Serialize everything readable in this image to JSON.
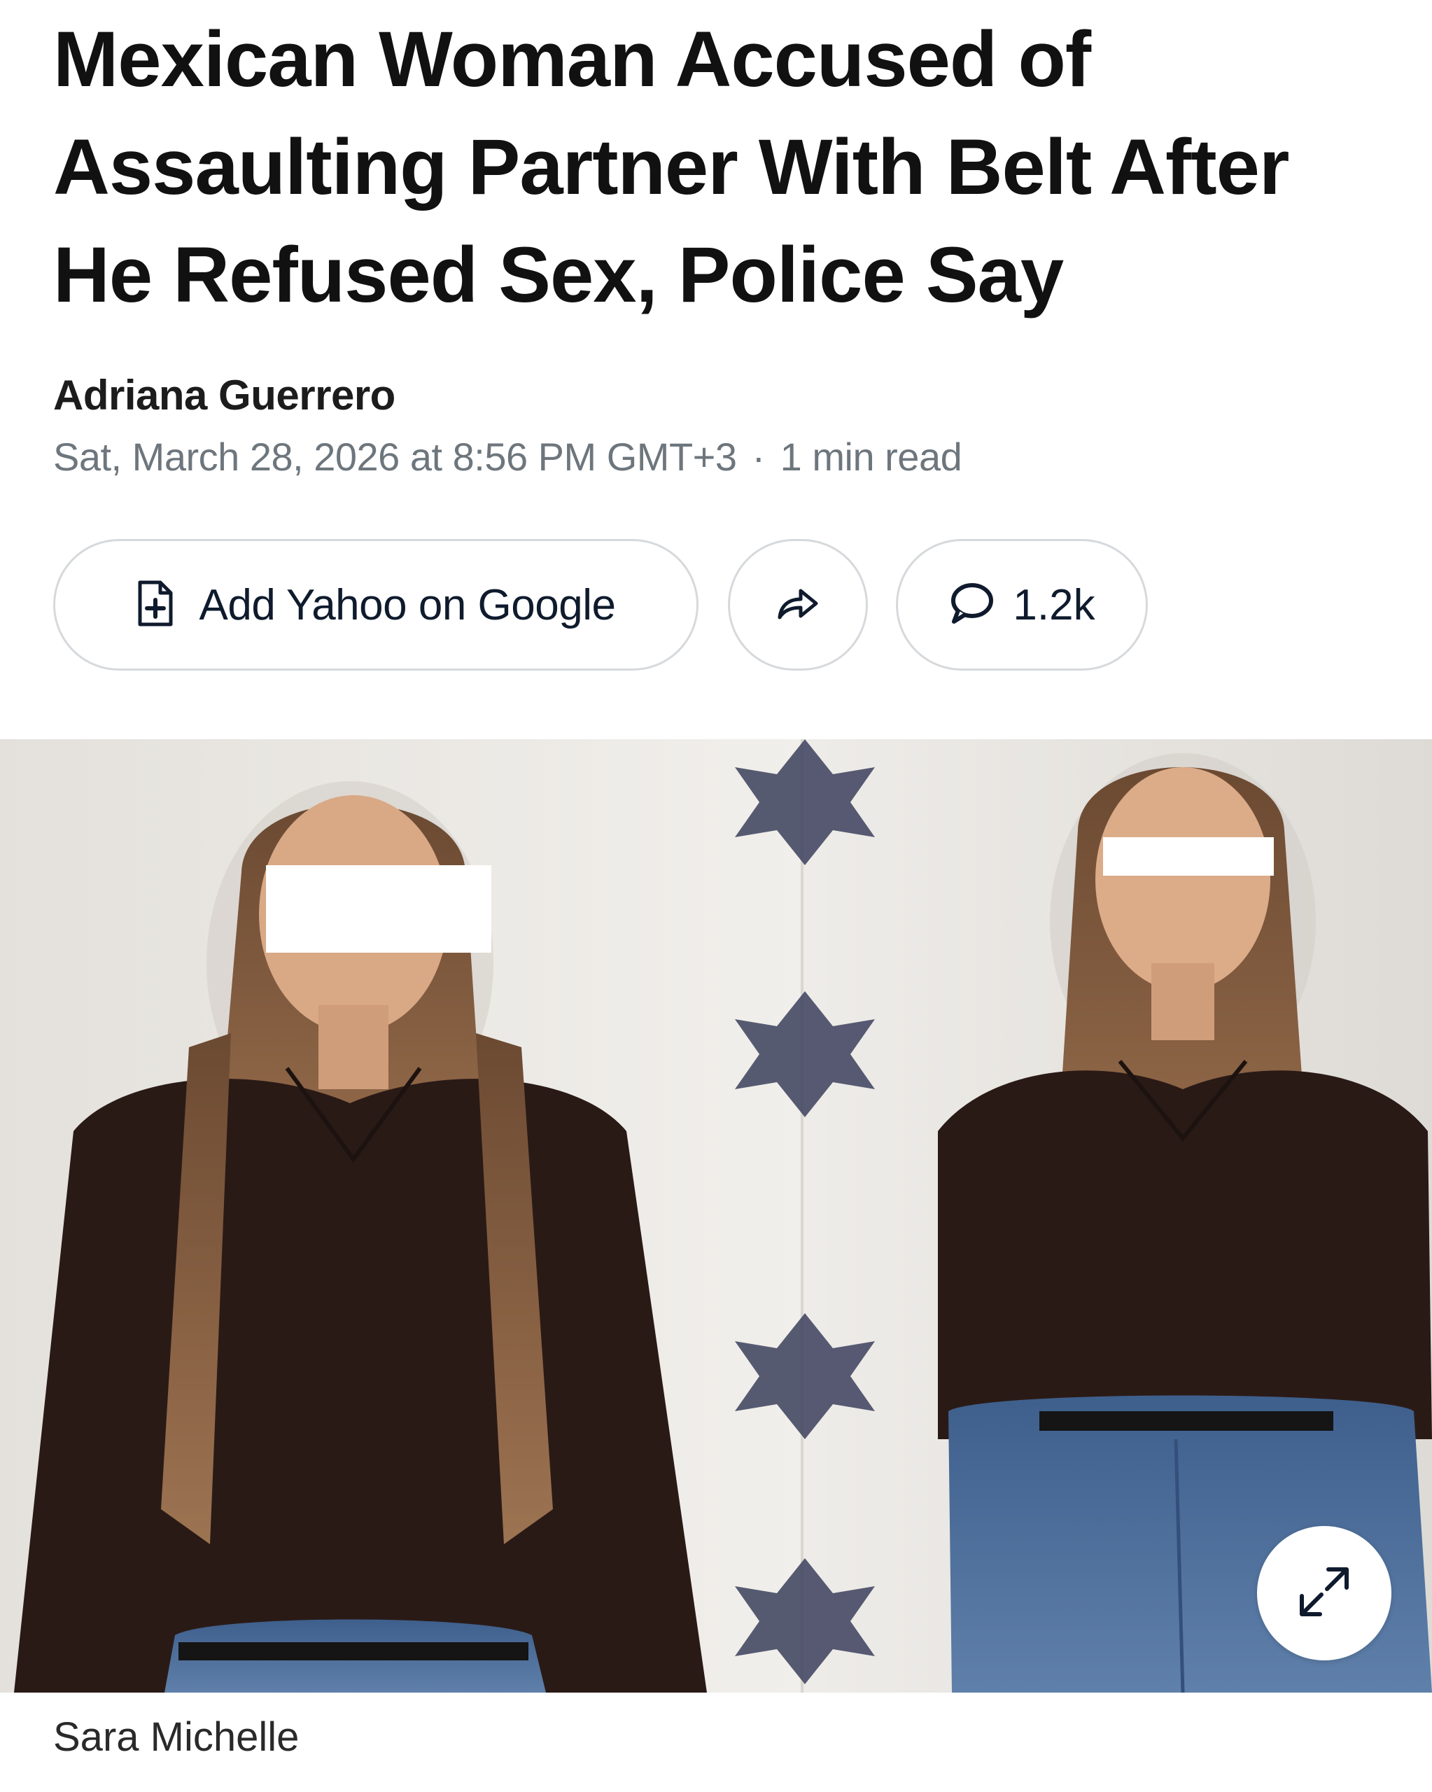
{
  "article": {
    "headline": "Mexican Woman Accused of Assaulting Partner With Belt After He Refused Sex, Police Say",
    "author": "Adriana Guerrero",
    "published": "Sat, March 28, 2026 at 8:56 PM GMT+3",
    "separator": "·",
    "read_time": "1 min read"
  },
  "actions": {
    "add_google_label": "Add Yahoo on Google",
    "comment_count": "1.2k"
  },
  "image": {
    "caption": "Sara Michelle"
  },
  "icons": {
    "add_google": "add-source-icon",
    "share": "share-arrow-icon",
    "comment": "comment-bubble-icon",
    "expand": "expand-icon"
  },
  "colors": {
    "text": "#111111",
    "meta": "#6e767d",
    "border": "#d6d9dc"
  }
}
